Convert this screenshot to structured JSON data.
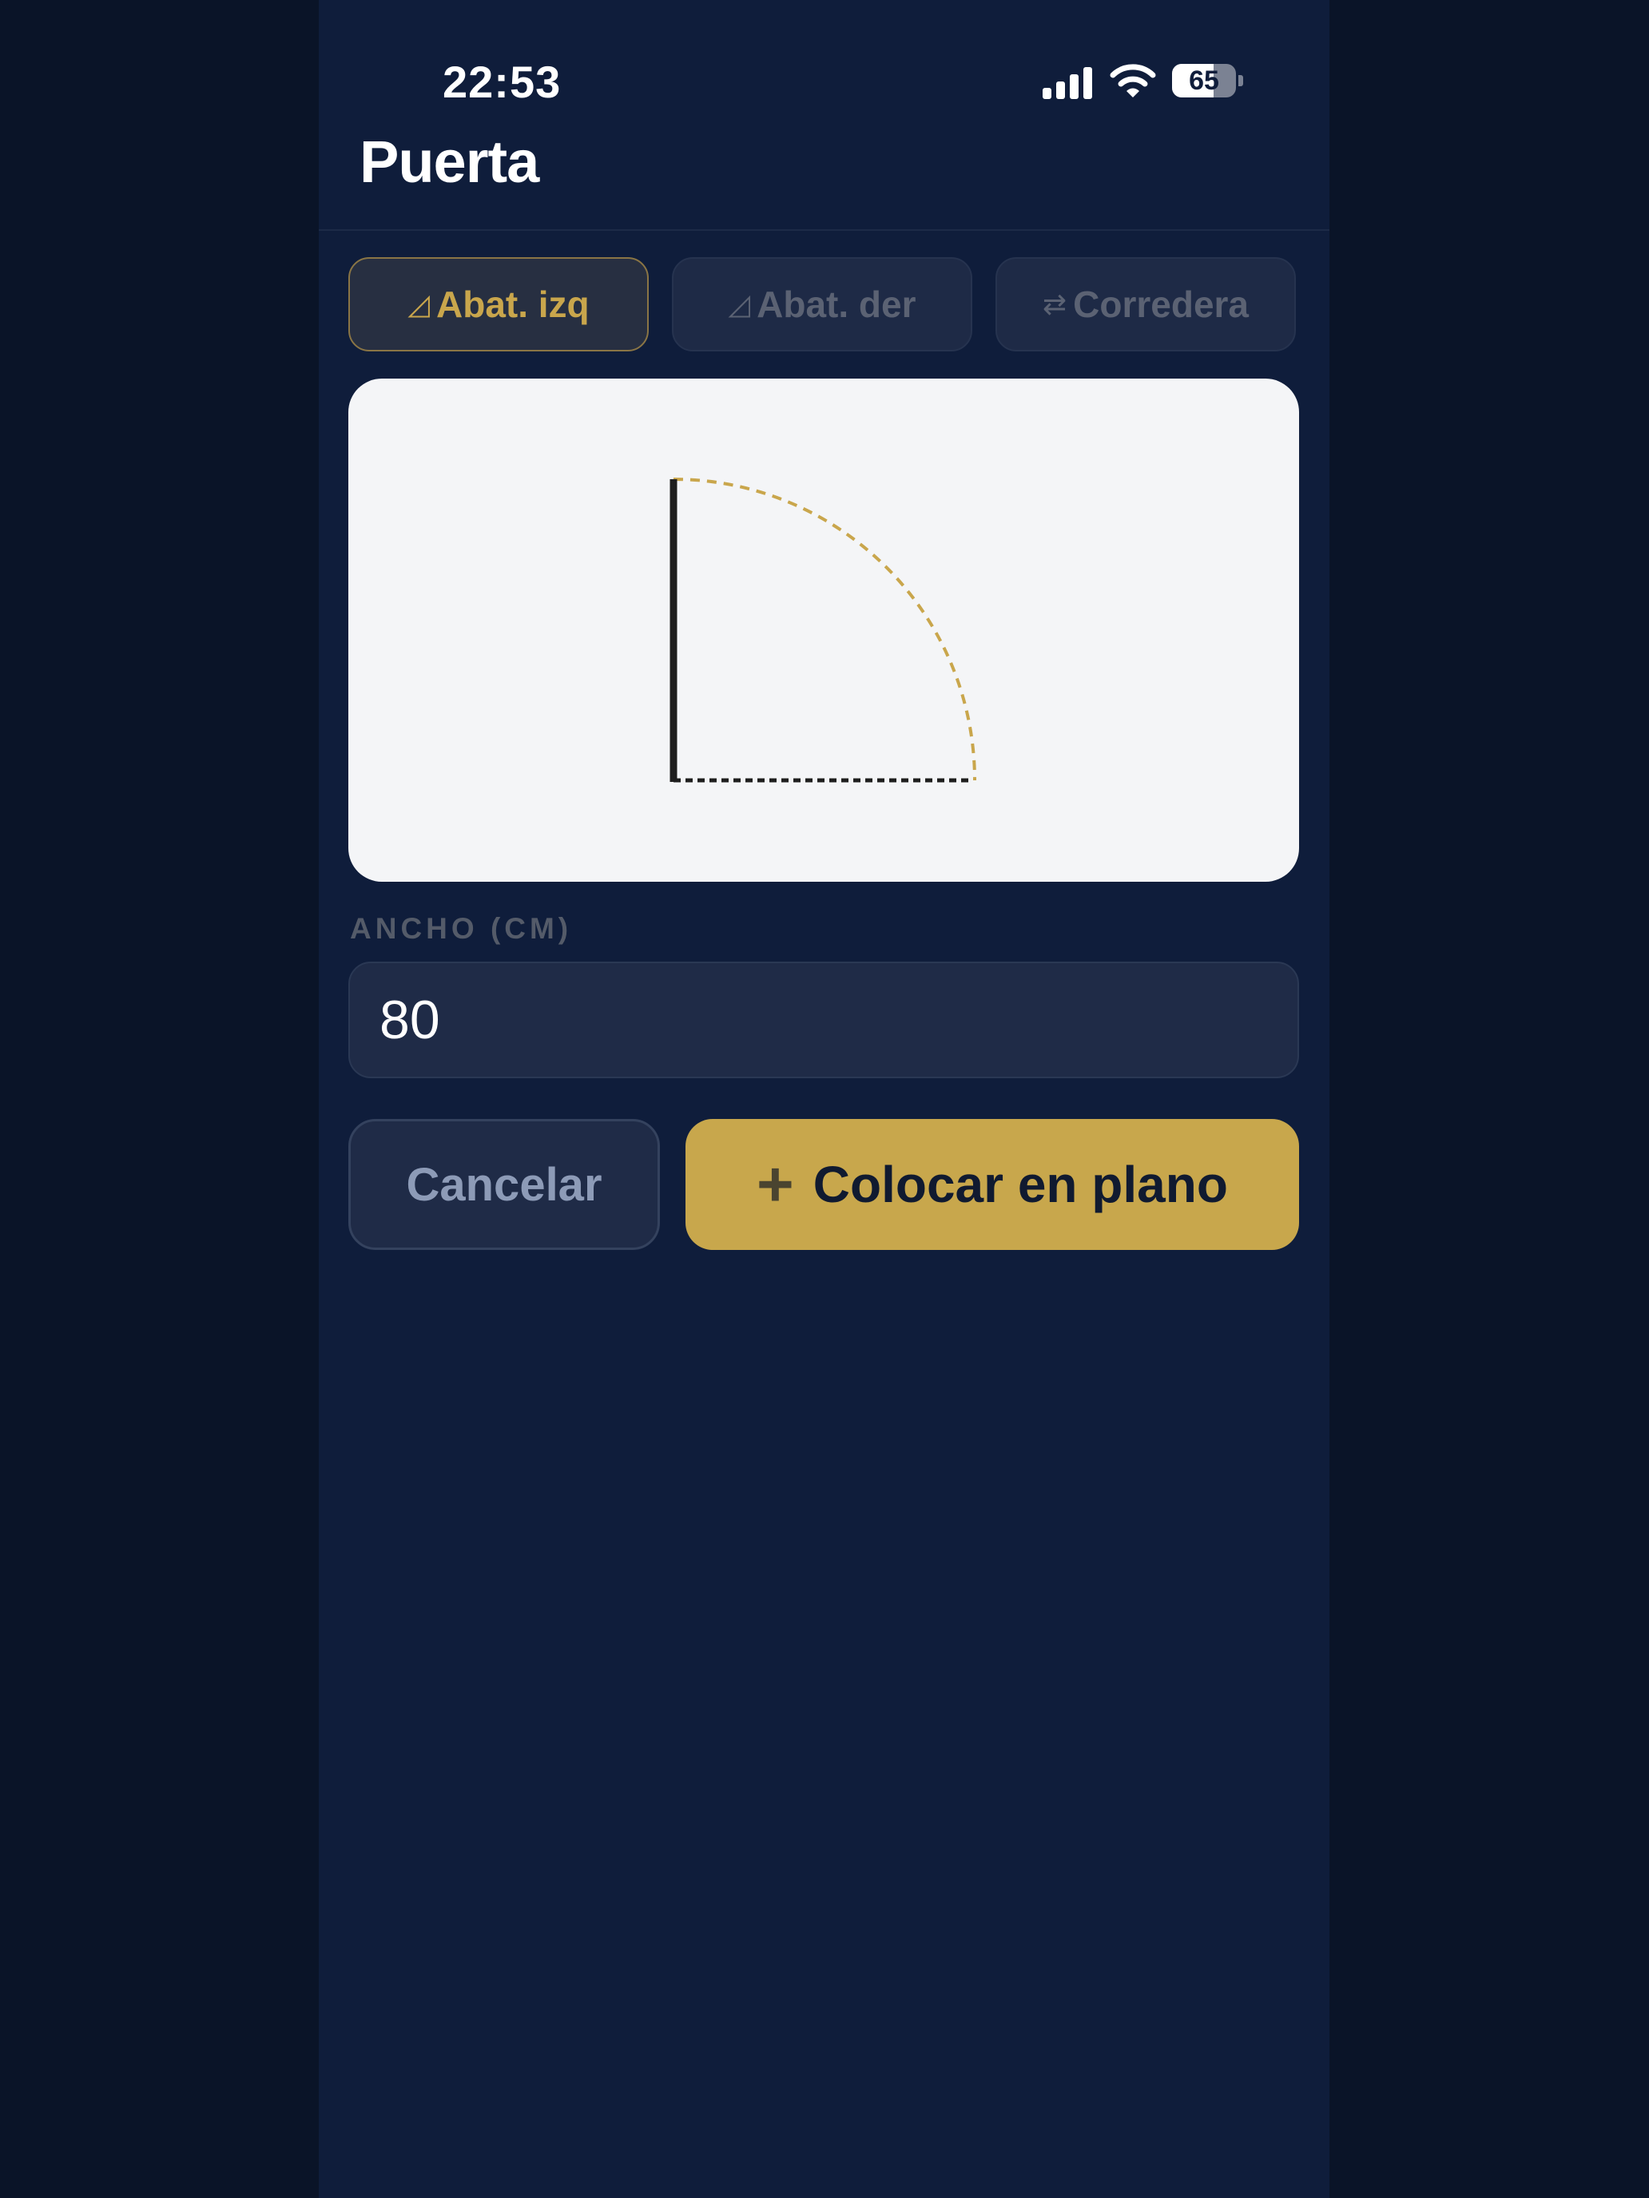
{
  "status_bar": {
    "time": "22:53",
    "battery": "65"
  },
  "header": {
    "title": "Puerta"
  },
  "door_types": [
    {
      "icon": "◿",
      "label": "Abat. izq",
      "active": true
    },
    {
      "icon": "◿",
      "label": "Abat. der",
      "active": false
    },
    {
      "icon": "⇄",
      "label": "Corredera",
      "active": false
    }
  ],
  "preview": {
    "arc_color": "#c9a64c",
    "door_color": "#1e1e1e"
  },
  "width_field": {
    "label": "ANCHO (CM)",
    "value": "80"
  },
  "actions": {
    "cancel_label": "Cancelar",
    "place_icon": "+",
    "place_label": "Colocar en plano"
  },
  "colors": {
    "accent": "#c8a74c",
    "background": "#0f1d3b"
  }
}
